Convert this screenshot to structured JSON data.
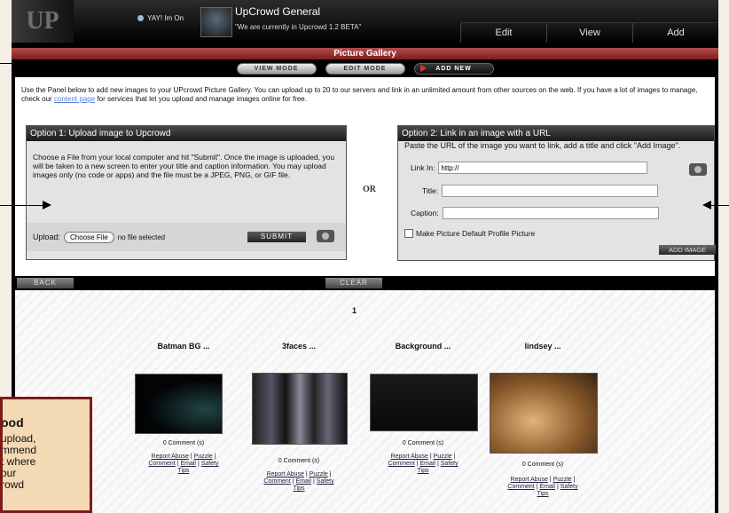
{
  "header": {
    "logo": "UP",
    "user_status": "YAY! Im On",
    "group_title": "UpCrowd General",
    "group_subtitle": "\"We are currently in Upcrowd 1.2 BETA\"",
    "nav": [
      "Edit",
      "View",
      "Add"
    ]
  },
  "gallery_header": "Picture Gallery",
  "modes": [
    "VIEW MODE",
    "EDIT MODE",
    "ADD NEW"
  ],
  "intro": {
    "part1": "Use the Panel below to add new images to your UPcrowd Picture Gallery. You can upload up to 20 to our servers and link in an unlimited amount from other sources on the web. If you have a lot of images to manage, check our ",
    "link": "content page",
    "part2": " for services that let you upload and manage images online for free."
  },
  "option1": {
    "title": "Option 1: Upload image to Upcrowd",
    "description": "Choose a File from your local computer and hit \"Submit\". Once the image is uploaded, you will be taken to a new screen to enter your title and caption information. You may upload images only (no code or apps) and the file must be a JPEG, PNG, or GIF file.",
    "upload_label": "Upload:",
    "choose_file": "Choose File",
    "no_file": "no file selected",
    "submit": "SUBMIT"
  },
  "or_text": "OR",
  "option2": {
    "title": "Option 2: Link in an image with a URL",
    "instructions": "Paste the URL of the image you want to link, add a title and click \"Add Image\".",
    "link_label": "Link In:",
    "link_value": "http://",
    "title_label": "Title:",
    "caption_label": "Caption:",
    "default_label": "Make Picture Default Profile Picture",
    "add_image": "ADD IMAGE"
  },
  "actions": {
    "back": "BACK",
    "clear": "CLEAR"
  },
  "page_number": "1",
  "items": [
    {
      "name": "Batman BG ...",
      "comments": "0 Comment (s)",
      "l1": "Report Abuse",
      "l2": "Puzzle",
      "l3": "Comment",
      "l4": "Email",
      "l5": "Safety",
      "l6": "Tips"
    },
    {
      "name": "3faces ...",
      "comments": "0 Comment (s)",
      "l1": "Report Abuse",
      "l2": "Puzzle",
      "l3": "Comment",
      "l4": "Email",
      "l5": "Safety",
      "l6": "Tips"
    },
    {
      "name": "Background ...",
      "comments": "0 Comment (s)",
      "l1": "Report Abuse",
      "l2": "Puzzle",
      "l3": "Comment",
      "l4": "Email",
      "l5": "Safety",
      "l6": "Tips"
    },
    {
      "name": "lindsey ...",
      "comments": "0 Comment (s)",
      "l1": "Report Abuse",
      "l2": "Puzzle",
      "l3": "Comment",
      "l4": "Email",
      "l5": "Safety",
      "l6": "Tips"
    }
  ],
  "callout": {
    "title": "ood",
    "lines": [
      "upload,",
      "mmend",
      "t where",
      "our",
      "rowd"
    ]
  },
  "colors": {
    "accent_red": "#9b2c2c",
    "callout_bg": "#f3d9b4",
    "callout_border": "#7b1b1b"
  }
}
